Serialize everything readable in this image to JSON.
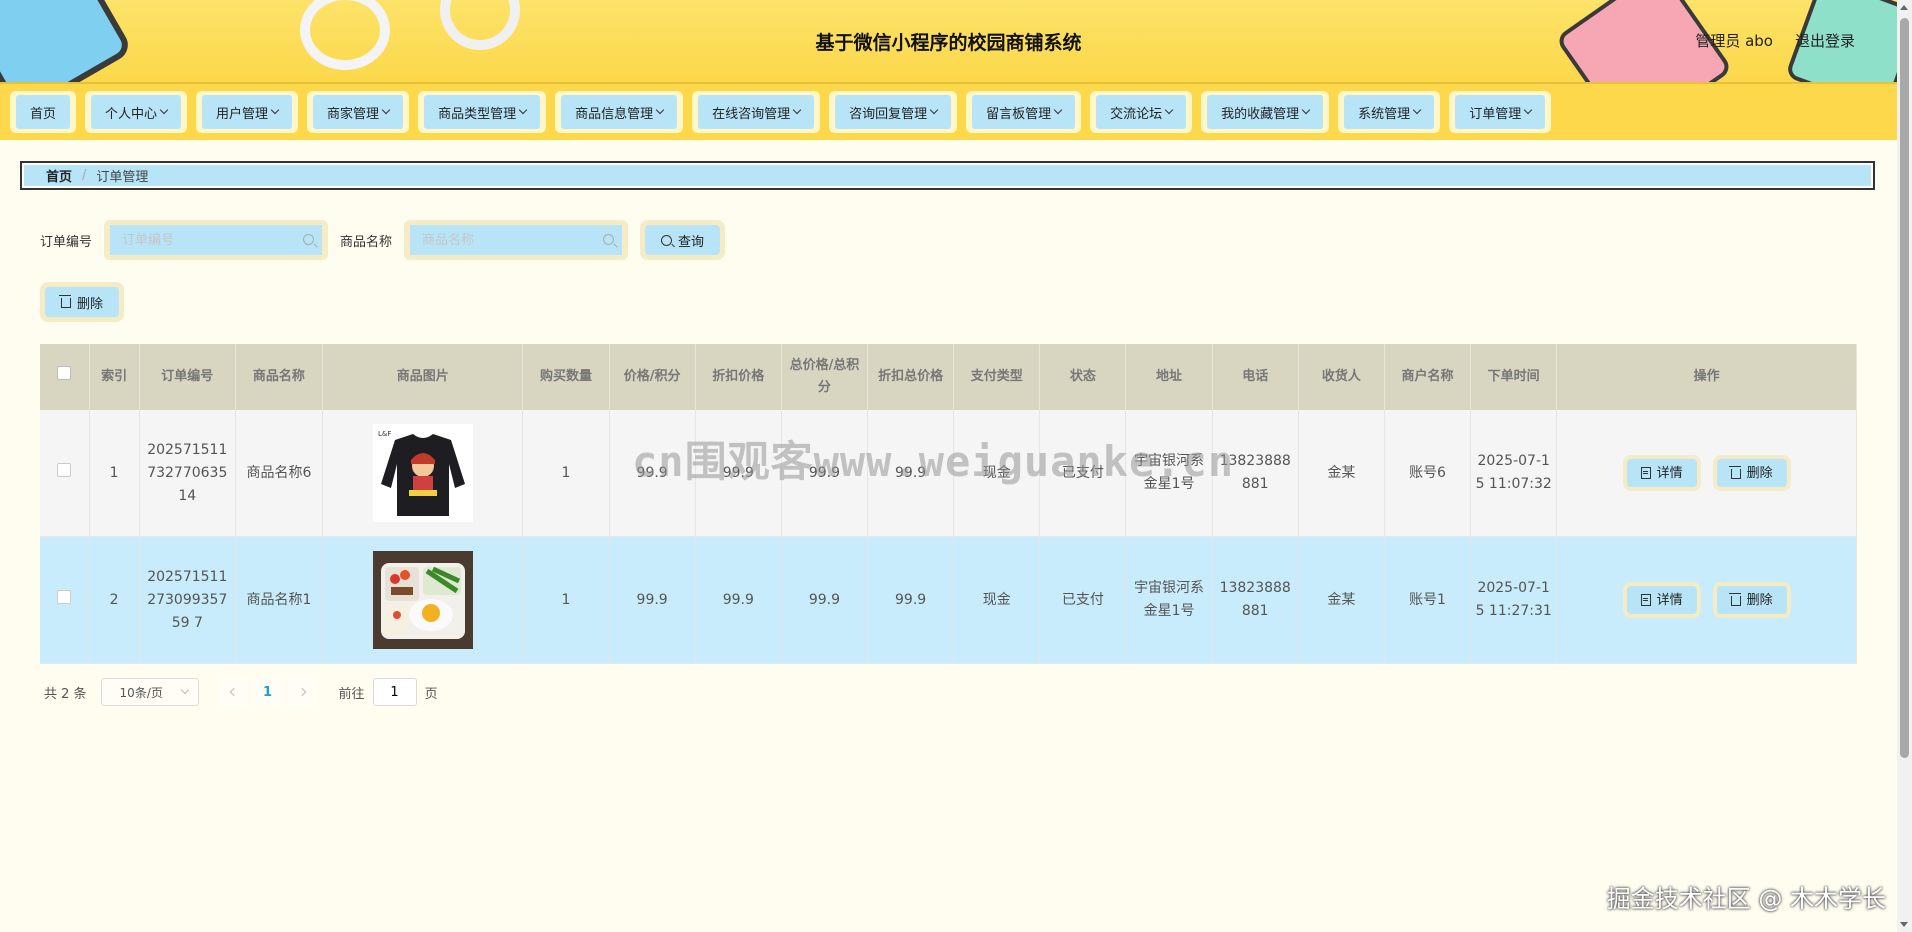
{
  "header": {
    "title": "基于微信小程序的校园商铺系统",
    "user": "管理员 abo",
    "logout": "退出登录"
  },
  "nav": [
    {
      "label": "首页",
      "dropdown": false
    },
    {
      "label": "个人中心",
      "dropdown": true
    },
    {
      "label": "用户管理",
      "dropdown": true
    },
    {
      "label": "商家管理",
      "dropdown": true
    },
    {
      "label": "商品类型管理",
      "dropdown": true
    },
    {
      "label": "商品信息管理",
      "dropdown": true
    },
    {
      "label": "在线咨询管理",
      "dropdown": true
    },
    {
      "label": "咨询回复管理",
      "dropdown": true
    },
    {
      "label": "留言板管理",
      "dropdown": true
    },
    {
      "label": "交流论坛",
      "dropdown": true
    },
    {
      "label": "我的收藏管理",
      "dropdown": true
    },
    {
      "label": "系统管理",
      "dropdown": true
    },
    {
      "label": "订单管理",
      "dropdown": true
    }
  ],
  "breadcrumb": {
    "home": "首页",
    "current": "订单管理"
  },
  "search": {
    "order_label": "订单编号",
    "order_placeholder": "订单编号",
    "product_label": "商品名称",
    "product_placeholder": "商品名称",
    "query_button": "查询"
  },
  "toolbar": {
    "delete_button": "删除"
  },
  "table": {
    "headers": [
      "索引",
      "订单编号",
      "商品名称",
      "商品图片",
      "购买数量",
      "价格/积分",
      "折扣价格",
      "总价格/总积分",
      "折扣总价格",
      "支付类型",
      "状态",
      "地址",
      "电话",
      "收货人",
      "商户名称",
      "下单时间",
      "操作"
    ],
    "rows": [
      {
        "index": "1",
        "order_no": "20257151173277063514",
        "product": "商品名称6",
        "image": "black-shirt",
        "qty": "1",
        "price": "99.9",
        "discount_price": "99.9",
        "total": "99.9",
        "discount_total": "99.9",
        "pay_type": "现金",
        "status": "已支付",
        "address": "宇宙银河系金星1号",
        "phone": "13823888881",
        "receiver": "金某",
        "merchant": "账号6",
        "time": "2025-07-15 11:07:32"
      },
      {
        "index": "2",
        "order_no": "20257151127309935759 7",
        "product": "商品名称1",
        "image": "bento-box",
        "qty": "1",
        "price": "99.9",
        "discount_price": "99.9",
        "total": "99.9",
        "discount_total": "99.9",
        "pay_type": "现金",
        "status": "已支付",
        "address": "宇宙银河系金星1号",
        "phone": "13823888881",
        "receiver": "金某",
        "merchant": "账号1",
        "time": "2025-07-15 11:27:31"
      }
    ],
    "detail_button": "详情",
    "delete_button": "删除"
  },
  "pagination": {
    "total": "共 2 条",
    "page_size": "10条/页",
    "current_page": "1",
    "goto_prefix": "前往",
    "goto_value": "1",
    "goto_suffix": "页"
  },
  "watermarks": {
    "center": "cn围观客www.weiguanke.cn",
    "bottom_right": "掘金技术社区 @ 木木学长"
  },
  "colors": {
    "header_bg": "#fcd84a",
    "accent_blue": "#b8e4f8",
    "row_highlight": "#c8ecfb",
    "page_bg": "#fffdf0"
  }
}
